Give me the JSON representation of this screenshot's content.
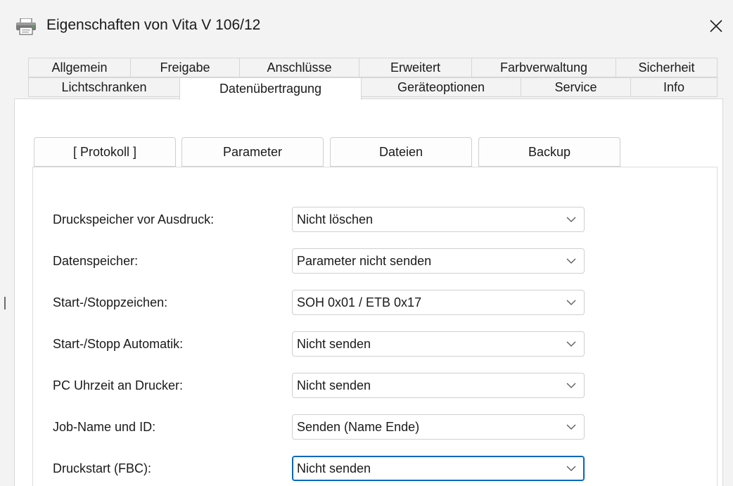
{
  "window": {
    "title": "Eigenschaften von Vita V 106/12",
    "app_icon": "printer-icon",
    "close_icon": "close-icon"
  },
  "tabs": {
    "row1": [
      "Allgemein",
      "Freigabe",
      "Anschlüsse",
      "Erweitert",
      "Farbverwaltung",
      "Sicherheit"
    ],
    "row2": [
      "Lichtschranken",
      "Datenübertragung",
      "Geräteoptionen",
      "Service",
      "Info"
    ],
    "active": "Datenübertragung"
  },
  "subtabs": {
    "items": [
      "[ Protokoll ]",
      "Parameter",
      "Dateien",
      "Backup"
    ],
    "active": "[ Protokoll ]"
  },
  "settings": [
    {
      "label": "Druckspeicher vor Ausdruck:",
      "value": "Nicht löschen"
    },
    {
      "label": "Datenspeicher:",
      "value": "Parameter nicht senden"
    },
    {
      "label": "Start-/Stoppzeichen:",
      "value": "SOH 0x01 / ETB 0x17"
    },
    {
      "label": "Start-/Stopp Automatik:",
      "value": "Nicht senden"
    },
    {
      "label": "PC Uhrzeit an Drucker:",
      "value": "Nicht senden"
    },
    {
      "label": "Job-Name und ID:",
      "value": "Senden (Name Ende)"
    },
    {
      "label": "Druckstart (FBC):",
      "value": "Nicht senden"
    }
  ],
  "focused_setting": "Druckstart (FBC):",
  "colors": {
    "focus": "#0067c0",
    "dialog_bg": "#f3f3f3",
    "page_bg": "#ffffff"
  }
}
